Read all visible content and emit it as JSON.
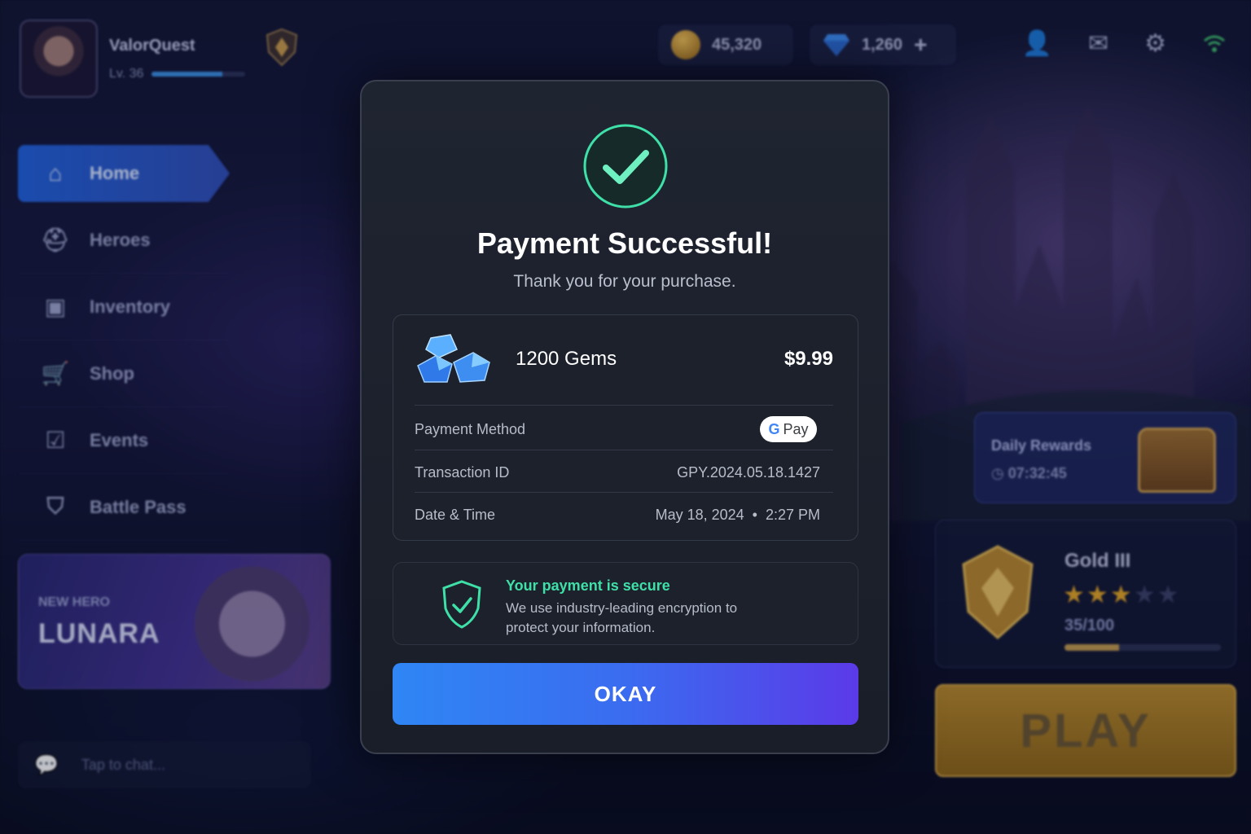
{
  "player": {
    "name": "ValorQuest",
    "level": "Lv. 36",
    "xp_fraction": 0.75
  },
  "currency": {
    "coins": "45,320",
    "gems": "1,260",
    "add_label": "+"
  },
  "sidebar": {
    "items": [
      {
        "label": "Home",
        "icon": "home-icon",
        "active": true
      },
      {
        "label": "Heroes",
        "icon": "helmet-icon"
      },
      {
        "label": "Inventory",
        "icon": "bag-icon"
      },
      {
        "label": "Shop",
        "icon": "cart-icon"
      },
      {
        "label": "Events",
        "icon": "calendar-check-icon"
      },
      {
        "label": "Battle Pass",
        "icon": "shield-star-icon"
      }
    ]
  },
  "hero_banner": {
    "tag": "NEW HERO",
    "name": "LUNARA"
  },
  "chat": {
    "placeholder": "Tap to chat..."
  },
  "daily_rewards": {
    "title": "Daily Rewards",
    "timer": "07:32:45"
  },
  "rank": {
    "name": "Gold III",
    "stars_filled": 2.5,
    "stars_total": 5,
    "progress": "35/100",
    "progress_fraction": 0.35
  },
  "play_label": "PLAY",
  "modal": {
    "title": "Payment Successful!",
    "subtitle": "Thank you for your purchase.",
    "item": {
      "name": "1200 Gems",
      "price": "$9.99"
    },
    "rows": {
      "payment_method_label": "Payment Method",
      "payment_method_value": "Pay",
      "transaction_label": "Transaction ID",
      "transaction_value": "GPY.2024.05.18.1427",
      "datetime_label": "Date & Time",
      "datetime_value": "May 18, 2024  •  2:27 PM"
    },
    "secure": {
      "title": "Your payment is secure",
      "text": "We use industry-leading encryption to protect your information."
    },
    "okay_label": "OKAY"
  },
  "colors": {
    "success": "#3fe0a8",
    "okay_start": "#2f86f4",
    "okay_end": "#5b3ae8",
    "gold": "#e2a423"
  }
}
